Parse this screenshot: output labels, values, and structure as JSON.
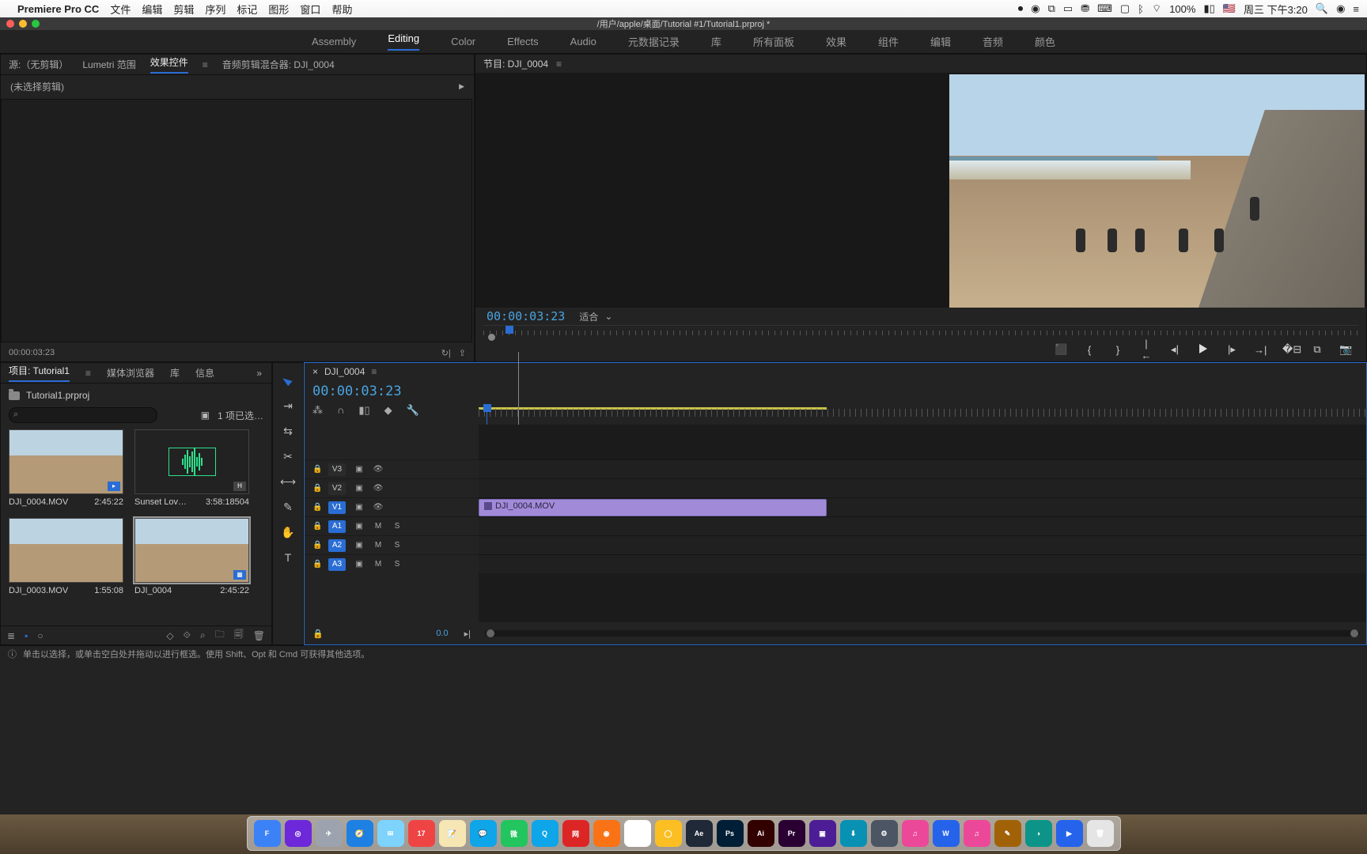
{
  "menubar": {
    "app": "Premiere Pro CC",
    "items": [
      "文件",
      "编辑",
      "剪辑",
      "序列",
      "标记",
      "图形",
      "窗口",
      "帮助"
    ],
    "battery": "100%",
    "clock": "周三 下午3:20"
  },
  "titlebar": {
    "path": "/用户/apple/桌面/Tutorial #1/Tutorial1.prproj *"
  },
  "workspaces": {
    "items": [
      "Assembly",
      "Editing",
      "Color",
      "Effects",
      "Audio",
      "元数据记录",
      "库",
      "所有面板",
      "效果",
      "组件",
      "编辑",
      "音频",
      "颜色"
    ],
    "active": "Editing"
  },
  "source_panel": {
    "tabs": {
      "source": "源:（无剪辑）",
      "lumetri": "Lumetri 范围",
      "effect": "效果控件",
      "audiomix": "音频剪辑混合器: DJI_0004"
    },
    "none_selected": "(未选择剪辑)",
    "tc": "00:00:03:23"
  },
  "program": {
    "title": "节目: DJI_0004",
    "tc": "00:00:03:23",
    "fit": "适合"
  },
  "transport": {
    "mark_in_icon": "{",
    "mark_out_icon": "}",
    "camera_icon": "📷"
  },
  "project": {
    "tabs": {
      "project": "项目: Tutorial1",
      "media": "媒体浏览器",
      "lib": "库",
      "info": "信息"
    },
    "file": "Tutorial1.prproj",
    "search_placeholder": "",
    "count": "1 项已选…",
    "bins": [
      {
        "name": "DJI_0004.MOV",
        "dur": "2:45:22",
        "kind": "beach"
      },
      {
        "name": "Sunset Lov…",
        "dur": "3:58:18504",
        "kind": "audio"
      },
      {
        "name": "DJI_0003.MOV",
        "dur": "1:55:08",
        "kind": "beach"
      },
      {
        "name": "DJI_0004",
        "dur": "2:45:22",
        "kind": "beach",
        "selected": true
      }
    ]
  },
  "timeline": {
    "seq": "DJI_0004",
    "tc": "00:00:03:23",
    "zoom": "0.0",
    "tracks_v": [
      "V3",
      "V2",
      "V1"
    ],
    "tracks_a": [
      "A1",
      "A2",
      "A3"
    ],
    "clip": "DJI_0004.MOV",
    "audio_m": "M",
    "audio_s": "S"
  },
  "status": {
    "text": "单击以选择，或单击空白处并拖动以进行框选。使用 Shift、Opt 和 Cmd 可获得其他选项。"
  },
  "dock": {
    "apps": [
      {
        "bg": "#3b82f6",
        "t": "F"
      },
      {
        "bg": "#6d28d9",
        "t": "◎"
      },
      {
        "bg": "#9ca3af",
        "t": "✈"
      },
      {
        "bg": "#1d80e2",
        "t": "🧭"
      },
      {
        "bg": "#7dd3fc",
        "t": "✉"
      },
      {
        "bg": "#ef4444",
        "t": "17"
      },
      {
        "bg": "#f5e6b3",
        "t": "📝"
      },
      {
        "bg": "#0ea5e9",
        "t": "💬"
      },
      {
        "bg": "#22c55e",
        "t": "微"
      },
      {
        "bg": "#0ea5e9",
        "t": "Q"
      },
      {
        "bg": "#dc2626",
        "t": "网"
      },
      {
        "bg": "#f97316",
        "t": "◉"
      },
      {
        "bg": "#fff",
        "t": "◯"
      },
      {
        "bg": "#fbbf24",
        "t": "◯"
      },
      {
        "bg": "#1f2937",
        "t": "Ae"
      },
      {
        "bg": "#001e36",
        "t": "Ps"
      },
      {
        "bg": "#330000",
        "t": "Ai"
      },
      {
        "bg": "#2a0033",
        "t": "Pr"
      },
      {
        "bg": "#4c1d95",
        "t": "▣"
      },
      {
        "bg": "#0891b2",
        "t": "⬇"
      },
      {
        "bg": "#4b5563",
        "t": "⚙"
      },
      {
        "bg": "#ec4899",
        "t": "♫"
      },
      {
        "bg": "#2563eb",
        "t": "W"
      },
      {
        "bg": "#ec4899",
        "t": "♫"
      },
      {
        "bg": "#a16207",
        "t": "✎"
      },
      {
        "bg": "#0d9488",
        "t": "◑"
      },
      {
        "bg": "#2563eb",
        "t": "▶"
      },
      {
        "bg": "#e5e5e5",
        "t": "🗑"
      }
    ]
  }
}
